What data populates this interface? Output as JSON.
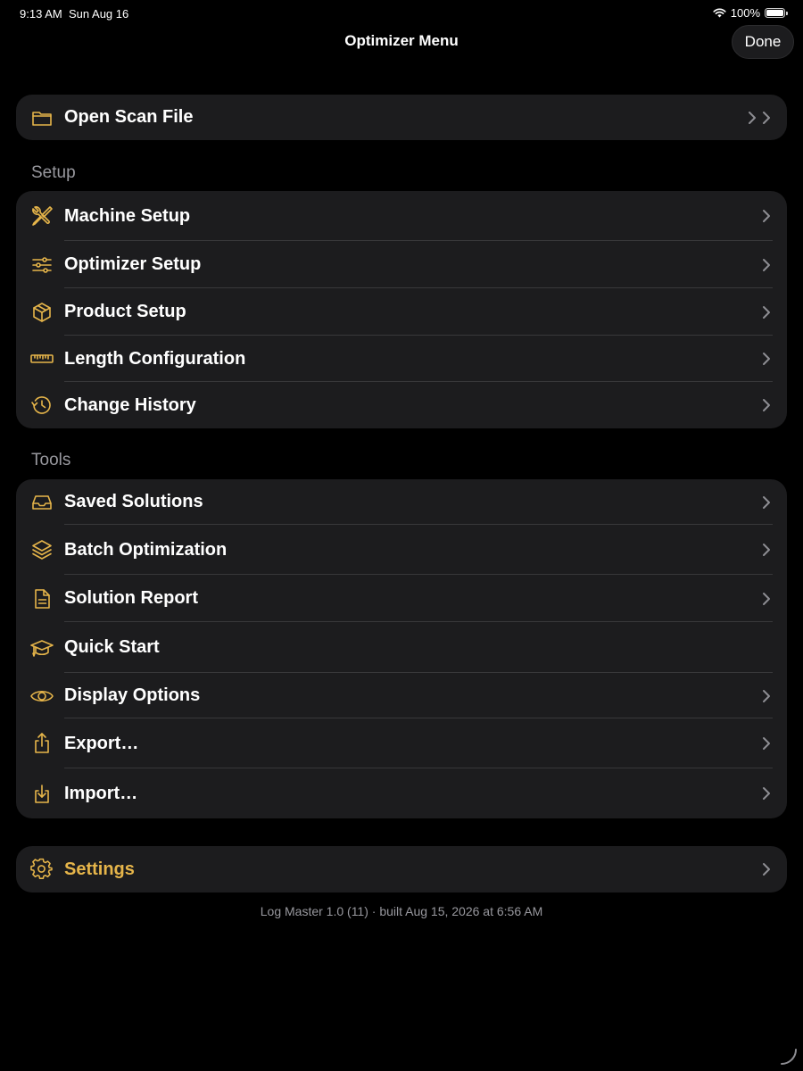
{
  "status": {
    "time": "9:13 AM",
    "date": "Sun Aug 16",
    "battery": "100%"
  },
  "nav": {
    "title": "Optimizer Menu",
    "done_label": "Done"
  },
  "open_scan": {
    "label": "Open Scan File",
    "icon": "folder-icon"
  },
  "setup": {
    "header": "Setup",
    "items": [
      {
        "label": "Machine Setup",
        "icon": "wrench-screwdriver-icon"
      },
      {
        "label": "Optimizer Setup",
        "icon": "sliders-icon"
      },
      {
        "label": "Product Setup",
        "icon": "box-icon"
      },
      {
        "label": "Length Configuration",
        "icon": "ruler-icon"
      },
      {
        "label": "Change History",
        "icon": "history-icon"
      }
    ]
  },
  "tools": {
    "header": "Tools",
    "items": [
      {
        "label": "Saved Solutions",
        "icon": "inbox-icon"
      },
      {
        "label": "Batch Optimization",
        "icon": "layers-icon"
      },
      {
        "label": "Solution Report",
        "icon": "document-icon"
      },
      {
        "label": "Quick Start",
        "icon": "graduation-cap-icon"
      },
      {
        "label": "Display Options",
        "icon": "eye-icon"
      },
      {
        "label": "Export…",
        "icon": "share-icon"
      },
      {
        "label": "Import…",
        "icon": "import-icon"
      }
    ]
  },
  "settings": {
    "label": "Settings",
    "icon": "gear-icon"
  },
  "footer": {
    "build_info": "Log Master 1.0 (11) · built Aug 15, 2026 at 6:56 AM"
  },
  "colors": {
    "accent": "#e6b54a",
    "background": "#000000",
    "group_background": "#1c1c1e",
    "secondary_text": "#98989e"
  }
}
